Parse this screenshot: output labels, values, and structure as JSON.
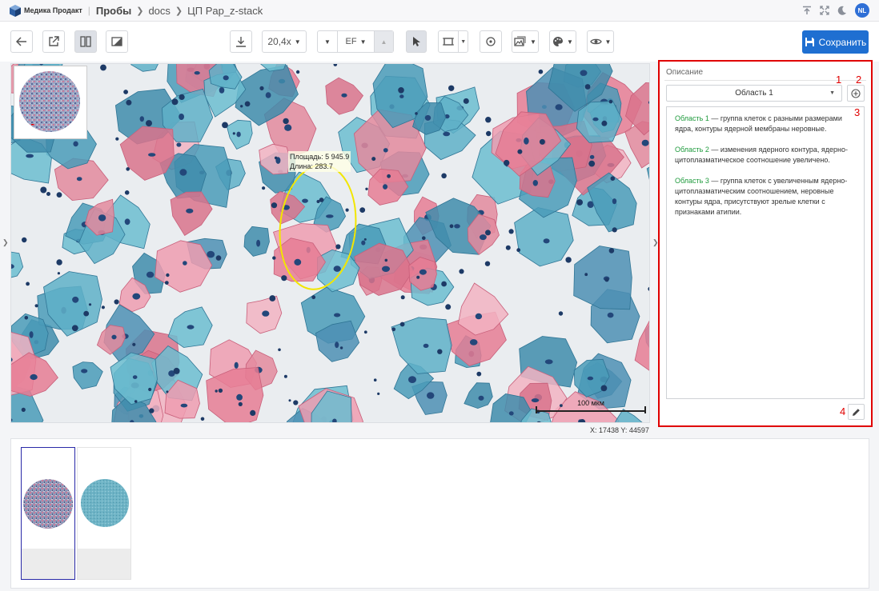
{
  "header": {
    "brand": "Медика Продакт",
    "breadcrumb": [
      "Пробы",
      "docs",
      "ЦП Pap_z-stack"
    ],
    "user_initials": "NL"
  },
  "toolbar": {
    "zoom": "20,4x",
    "filter": "EF",
    "save_label": "Сохранить"
  },
  "viewer": {
    "measure_area": "Площадь: 5 945.9",
    "measure_length": "Длина: 283.7",
    "scalebar_label": "100 мкм",
    "coords": "X: 17438  Y: 44597"
  },
  "panel": {
    "title": "Описание",
    "region_select": "Область 1",
    "annotations": [
      "1",
      "2",
      "3",
      "4"
    ],
    "entries": [
      {
        "label": "Область 1",
        "text": " — группа клеток с разными размерами ядра, контуры ядерной мембраны неровные."
      },
      {
        "label": "Область 2",
        "text": " —  изменения ядерного контура, ядерно-цитоплазматическое соотношение увеличено."
      },
      {
        "label": "Область 3",
        "text": " — группа клеток с увеличенным ядерно-цитоплазматическим соотношением, неровные контуры ядра, присутствуют зрелые клетки с признаками атипии."
      }
    ]
  },
  "colors": {
    "accent": "#1f6fd1",
    "highlight_border": "#e00000",
    "area_label": "#1e9a3c",
    "cyan_cell": "#4a9bb8",
    "pink_cell": "#e38a9e",
    "nucleus": "#23477a",
    "selection_ellipse": "#f2e600"
  }
}
